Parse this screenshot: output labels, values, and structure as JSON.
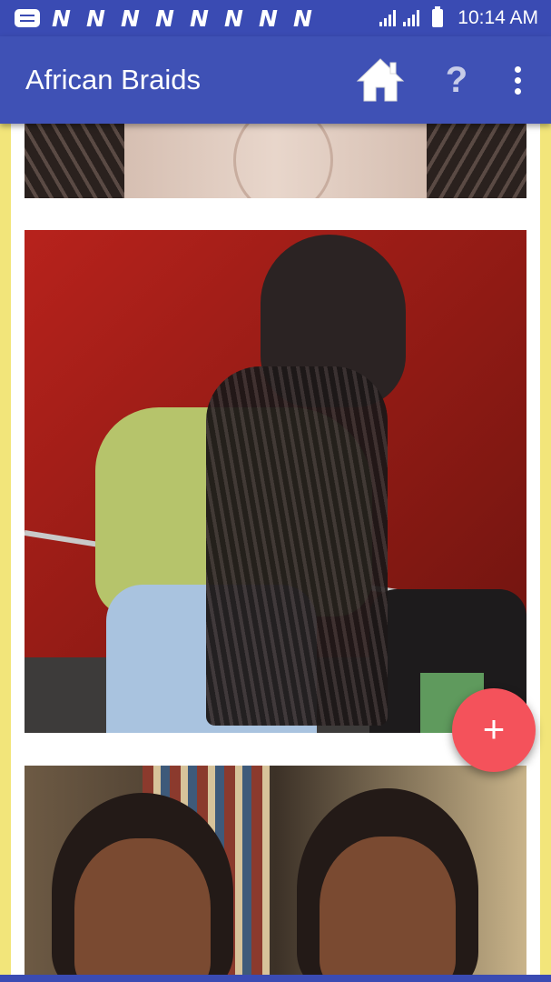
{
  "status_bar": {
    "notification_letters": [
      "N",
      "N",
      "N",
      "N",
      "N",
      "N",
      "N",
      "N"
    ],
    "time": "10:14 AM",
    "icons": [
      "message-icon",
      "signal-icon",
      "signal-icon",
      "battery-icon"
    ]
  },
  "app_bar": {
    "title": "African Braids",
    "help_label": "?",
    "icons": [
      "home-icon",
      "help-icon",
      "more-vert-icon"
    ]
  },
  "fab": {
    "label": "+"
  },
  "colors": {
    "status_bar": "#3a4bb3",
    "app_bar": "#3f51b5",
    "fab": "#f4525b",
    "page_background": "#f2e57a"
  }
}
